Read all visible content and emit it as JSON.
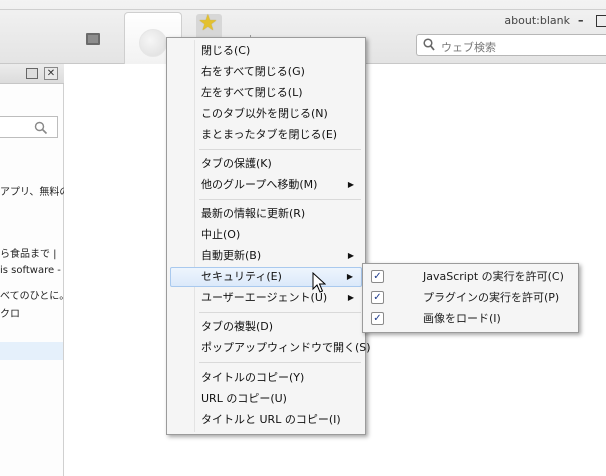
{
  "browser": {
    "address_text": "about:blank",
    "search_placeholder": "ウェブ検索",
    "window_min_label": "–"
  },
  "panel": {
    "lines": [
      "アプリ、無料の",
      "ら食品まで |",
      "is software -",
      "べてのひとに。",
      "クロ"
    ]
  },
  "context_menu": {
    "groups": [
      [
        {
          "label": "閉じる(C)"
        },
        {
          "label": "右をすべて閉じる(G)"
        },
        {
          "label": "左をすべて閉じる(L)"
        },
        {
          "label": "このタブ以外を閉じる(N)"
        },
        {
          "label": "まとまったタブを閉じる(E)"
        }
      ],
      [
        {
          "label": "タブの保護(K)"
        },
        {
          "label": "他のグループへ移動(M)",
          "submenu": true
        }
      ],
      [
        {
          "label": "最新の情報に更新(R)"
        },
        {
          "label": "中止(O)"
        },
        {
          "label": "自動更新(B)",
          "submenu": true
        },
        {
          "label": "セキュリティ(E)",
          "submenu": true,
          "highlighted": true
        },
        {
          "label": "ユーザーエージェント(U)",
          "submenu": true
        }
      ],
      [
        {
          "label": "タブの複製(D)"
        },
        {
          "label": "ポップアップウィンドウで開く(S)"
        }
      ],
      [
        {
          "label": "タイトルのコピー(Y)"
        },
        {
          "label": "URL のコピー(U)"
        },
        {
          "label": "タイトルと URL のコピー(I)"
        }
      ]
    ]
  },
  "security_submenu": {
    "items": [
      {
        "label": "JavaScript の実行を許可(C)",
        "checked": true
      },
      {
        "label": "プラグインの実行を許可(P)",
        "checked": true
      },
      {
        "label": "画像をロード(I)",
        "checked": true
      }
    ]
  },
  "colors": {
    "highlight": "#dbe9fa",
    "menu_bg": "#f5f5f5",
    "star": "#e3c12f"
  }
}
